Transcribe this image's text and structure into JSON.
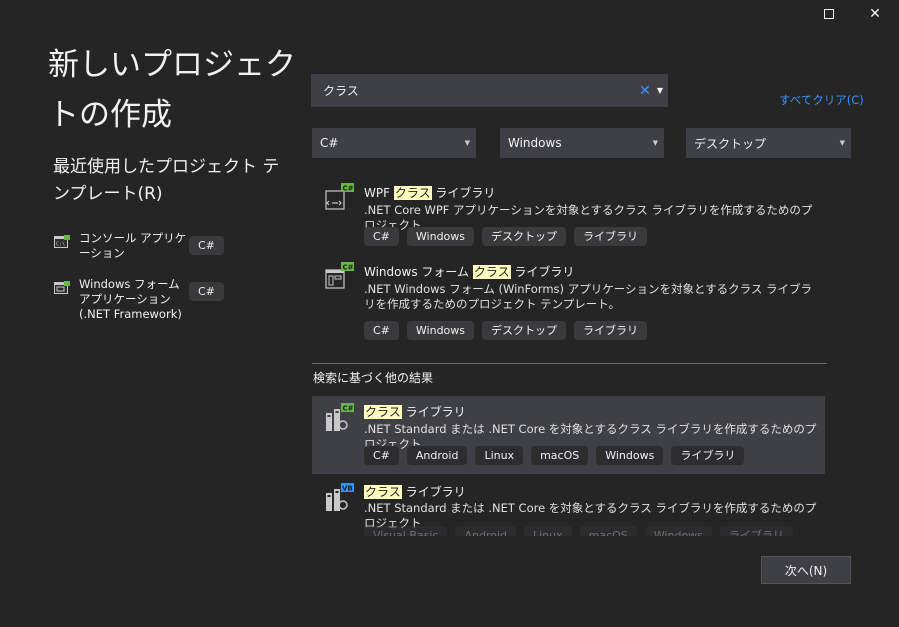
{
  "window": {
    "maximize_icon": "maximize-icon",
    "close_icon": "close-icon",
    "close_glyph": "✕"
  },
  "title": "新しいプロジェクトの作成",
  "recent": {
    "heading": "最近使用したプロジェクト テンプレート(R)",
    "items": [
      {
        "label": "コンソール アプリケーション",
        "tag": "C#",
        "icon": "console-app-icon"
      },
      {
        "label": "Windows フォーム アプリケーション (.NET Framework)",
        "tag": "C#",
        "icon": "windows-forms-icon"
      }
    ]
  },
  "search": {
    "value": "クラス",
    "clear_glyph": "✕",
    "dropdown_glyph": "▼"
  },
  "clear_all": "すべてクリア(C)",
  "filters": {
    "language": "C#",
    "platform": "Windows",
    "project_type": "デスクトップ",
    "arrow_glyph": "▼"
  },
  "templates": [
    {
      "name_before": "WPF ",
      "name_highlight": "クラス",
      "name_after": " ライブラリ",
      "desc": ".NET Core WPF アプリケーションを対象とするクラス ライブラリを作成するためのプロジェクト",
      "tags": [
        "C#",
        "Windows",
        "デスクトップ",
        "ライブラリ"
      ],
      "icon": "wpf-class-library-icon",
      "lang_badge": "C#"
    },
    {
      "name_before": "Windows フォーム ",
      "name_highlight": "クラス",
      "name_after": " ライブラリ",
      "desc": ".NET Windows フォーム (WinForms) アプリケーションを対象とするクラス ライブラリを作成するためのプロジェクト テンプレート。",
      "tags": [
        "C#",
        "Windows",
        "デスクトップ",
        "ライブラリ"
      ],
      "icon": "winforms-class-library-icon",
      "lang_badge": "C#"
    }
  ],
  "other_results": {
    "heading": "検索に基づく他の結果",
    "items": [
      {
        "name_before": "",
        "name_highlight": "クラス",
        "name_after": " ライブラリ",
        "desc": ".NET Standard または .NET Core を対象とするクラス ライブラリを作成するためのプロジェクト",
        "tags": [
          "C#",
          "Android",
          "Linux",
          "macOS",
          "Windows",
          "ライブラリ"
        ],
        "icon": "class-library-csharp-icon",
        "lang_badge": "C#"
      },
      {
        "name_before": "",
        "name_highlight": "クラス",
        "name_after": " ライブラリ",
        "desc": ".NET Standard または .NET Core を対象とするクラス ライブラリを作成するためのプロジェクト",
        "tags": [
          "Visual Basic",
          "Android",
          "Linux",
          "macOS",
          "Windows",
          "ライブラリ"
        ],
        "icon": "class-library-vb-icon",
        "lang_badge": "VB"
      }
    ]
  },
  "next_button": "次へ(N)",
  "colors": {
    "background": "#252526",
    "accent": "#3794ff",
    "highlight": "#fffcbf",
    "selected": "#3f3f46",
    "csharp_badge": "#68b645",
    "vb_badge": "#3794ff"
  }
}
